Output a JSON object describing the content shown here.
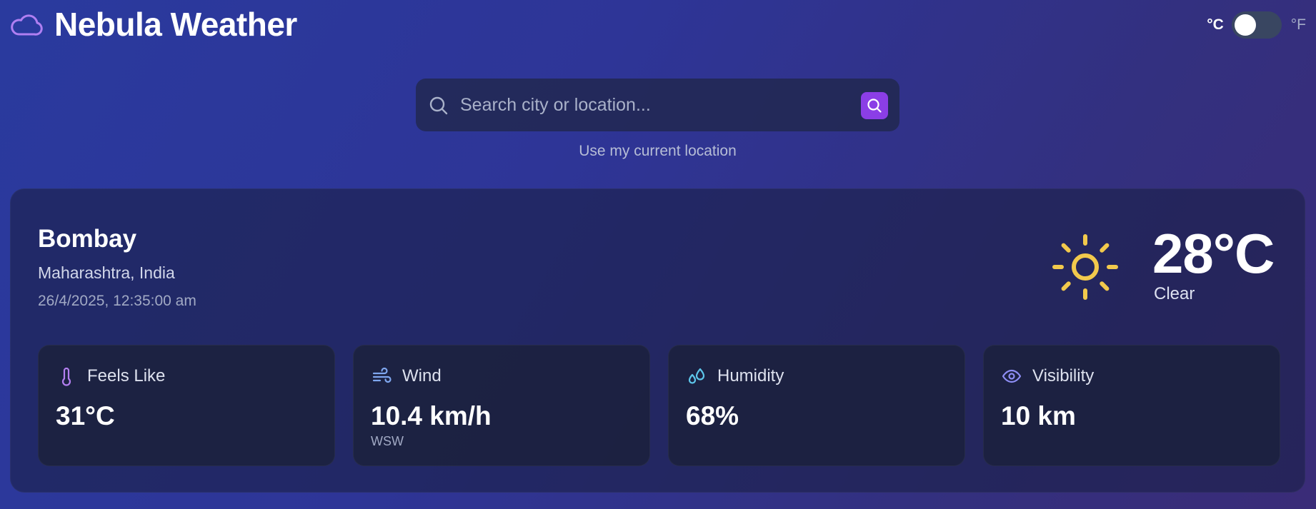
{
  "header": {
    "app_title": "Nebula Weather",
    "icon": "cloud-icon",
    "unit_toggle": {
      "celsius_label": "°C",
      "fahrenheit_label": "°F",
      "selected": "°C"
    }
  },
  "search": {
    "placeholder": "Search city or location...",
    "value": "",
    "button_icon": "search-icon",
    "current_location_label": "Use my current location"
  },
  "weather": {
    "city": "Bombay",
    "region": "Maharashtra, India",
    "datetime": "26/4/2025, 12:35:00 am",
    "temperature": "28°C",
    "condition": "Clear",
    "condition_icon": "sun-icon",
    "stats": [
      {
        "label": "Feels Like",
        "value": "31°C",
        "sub": "",
        "icon": "thermometer-icon"
      },
      {
        "label": "Wind",
        "value": "10.4 km/h",
        "sub": "WSW",
        "icon": "wind-icon"
      },
      {
        "label": "Humidity",
        "value": "68%",
        "sub": "",
        "icon": "droplets-icon"
      },
      {
        "label": "Visibility",
        "value": "10 km",
        "sub": "",
        "icon": "eye-icon"
      }
    ]
  },
  "colors": {
    "accent": "#8b3ee6",
    "sun": "#f2c94c",
    "thermometer": "#b37ff0",
    "wind": "#7fa7ef",
    "humidity": "#5dc6ea",
    "visibility": "#8e8ef5"
  }
}
